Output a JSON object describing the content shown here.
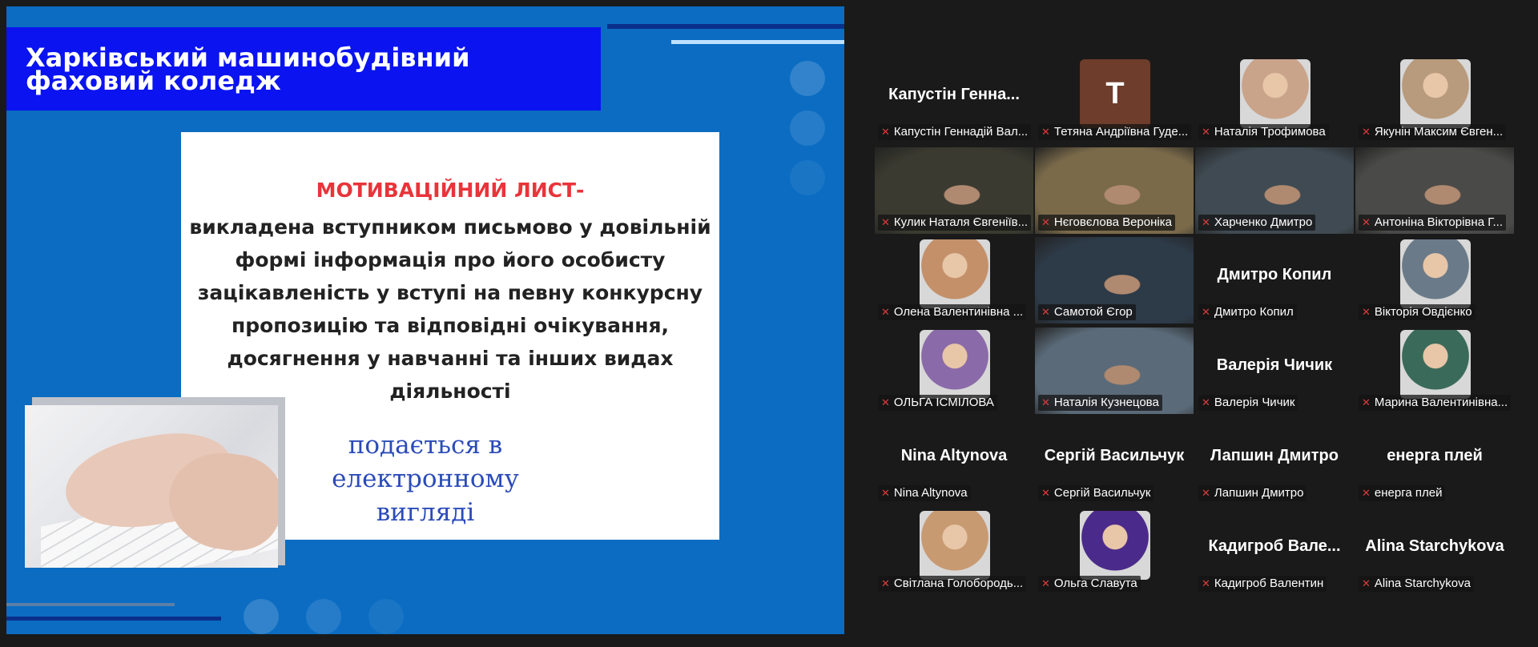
{
  "slide": {
    "title_line1": "Харківський машинобудівний",
    "title_line2": "фаховий коледж",
    "heading": "МОТИВАЦІЙНИЙ ЛИСТ-",
    "body": "викладена вступником письмово у довільній формі інформація про його особисту зацікавленість у вступі на певну конкурсну пропозицію та відповідні очікування, досягнення у навчанні та інших видах діяльності",
    "note": "подається в електронному вигляді"
  },
  "participants": [
    {
      "name": "Капустін Геннадій Вал...",
      "big": "Капустін Генна...",
      "kind": "name"
    },
    {
      "name": "Тетяна Андріївна Гуде...",
      "avatar_letter": "T",
      "kind": "letter"
    },
    {
      "name": "Наталія Трофимова",
      "kind": "photo",
      "color": "#c9a48a"
    },
    {
      "name": "Якунін Максим Євген...",
      "kind": "photo",
      "color": "#b89a7c"
    },
    {
      "name": "Кулик Наталя Євгеніїв...",
      "kind": "video",
      "color": "#3a3a30"
    },
    {
      "name": "Нєговєлова Вероніка",
      "kind": "video",
      "color": "#7a6a4a"
    },
    {
      "name": "Харченко Дмитро",
      "kind": "video",
      "color": "#3f4a52"
    },
    {
      "name": "Антоніна Вікторівна Г...",
      "kind": "video",
      "color": "#4a4a48"
    },
    {
      "name": "Олена Валентинівна ...",
      "kind": "photo",
      "color": "#c4906a"
    },
    {
      "name": "Самотой Єгор",
      "kind": "video",
      "color": "#2d3a48"
    },
    {
      "name": "Дмитро Копил",
      "big": "Дмитро Копил",
      "kind": "name"
    },
    {
      "name": "Вікторія Овдієнко",
      "kind": "photo",
      "color": "#6a7a88"
    },
    {
      "name": "ОЛЬГА ІСМІЛОВА",
      "kind": "photo",
      "color": "#8a6aa8"
    },
    {
      "name": "Наталія Кузнецова",
      "kind": "video",
      "color": "#5a6a78",
      "active": true
    },
    {
      "name": "Валерія Чичик",
      "big": "Валерія Чичик",
      "kind": "name"
    },
    {
      "name": "Марина Валентинівна...",
      "kind": "photo",
      "color": "#3a6a5a"
    },
    {
      "name": "Nina Altynova",
      "big": "Nina Altynova",
      "kind": "name"
    },
    {
      "name": "Сергій Васильчук",
      "big": "Сергій  Васильчук",
      "kind": "name"
    },
    {
      "name": "Лапшин Дмитро",
      "big": "Лапшин Дмитро",
      "kind": "name"
    },
    {
      "name": "енерга плей",
      "big": "енерга плей",
      "kind": "name"
    },
    {
      "name": "Світлана Голобородь...",
      "kind": "photo",
      "color": "#c89a72"
    },
    {
      "name": "Ольга Славута",
      "kind": "photo",
      "color": "#4a2a8a"
    },
    {
      "name": "Кадигроб Валентин",
      "big": "Кадигроб  Вале...",
      "kind": "name"
    },
    {
      "name": "Alina Starchykova",
      "big": "Alina Starchykova",
      "kind": "name"
    }
  ]
}
